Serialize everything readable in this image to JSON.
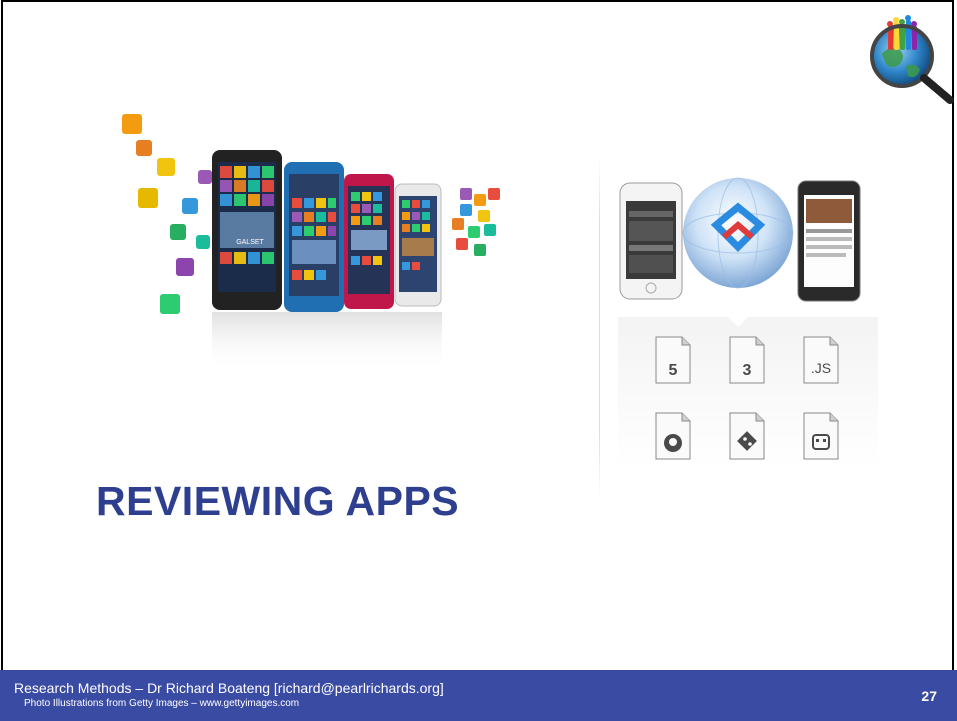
{
  "slide": {
    "title": "REVIEWING APPS",
    "page_number": "27"
  },
  "footer": {
    "line1": "Research Methods – Dr Richard Boateng [richard@pearlrichards.org]",
    "line2": "Photo Illustrations from Getty Images – www.gettyimages.com"
  },
  "illustrations": {
    "file_labels": [
      "5",
      "3",
      ".JS"
    ],
    "phone_screen_text": "GALSET"
  },
  "colors": {
    "title": "#2e3f8f",
    "footer_bg": "#3a4ba4"
  }
}
